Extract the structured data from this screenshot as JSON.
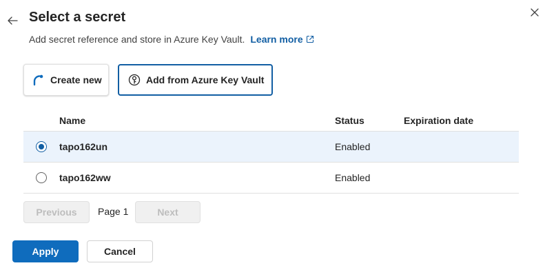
{
  "header": {
    "title": "Select a secret",
    "subtitle": "Add secret reference and store in Azure Key Vault.",
    "learn_more": "Learn more",
    "back_icon": "arrow-left-icon",
    "close_icon": "close-icon"
  },
  "tiles": {
    "create_new": "Create new",
    "add_from_kv": "Add from Azure Key Vault",
    "selected": "add_from_kv"
  },
  "table": {
    "columns": {
      "name": "Name",
      "status": "Status",
      "expiration": "Expiration date"
    },
    "rows": [
      {
        "name": "tapo162un",
        "status": "Enabled",
        "expiration": "",
        "selected": true
      },
      {
        "name": "tapo162ww",
        "status": "Enabled",
        "expiration": "",
        "selected": false
      }
    ]
  },
  "pagination": {
    "previous": "Previous",
    "page": "Page 1",
    "next": "Next"
  },
  "footer": {
    "apply": "Apply",
    "cancel": "Cancel"
  },
  "colors": {
    "accent": "#0f6cbd",
    "link": "#115ea3",
    "selected_row": "#ebf3fc"
  }
}
